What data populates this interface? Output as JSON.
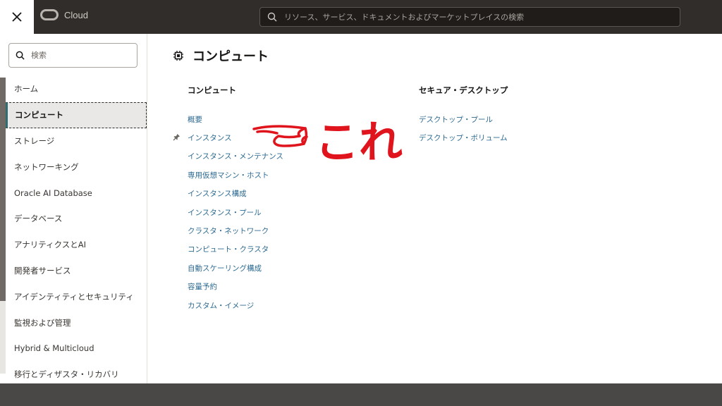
{
  "header": {
    "brand": "Cloud",
    "search_placeholder": "リソース、サービス、ドキュメントおよびマーケットプレイスの検索"
  },
  "sidebar": {
    "search_placeholder": "検索",
    "items": [
      {
        "label": "ホーム",
        "active": false
      },
      {
        "label": "コンピュート",
        "active": true
      },
      {
        "label": "ストレージ",
        "active": false
      },
      {
        "label": "ネットワーキング",
        "active": false
      },
      {
        "label": "Oracle AI Database",
        "active": false
      },
      {
        "label": "データベース",
        "active": false
      },
      {
        "label": "アナリティクスとAI",
        "active": false
      },
      {
        "label": "開発者サービス",
        "active": false
      },
      {
        "label": "アイデンティティとセキュリティ",
        "active": false
      },
      {
        "label": "監視および管理",
        "active": false
      },
      {
        "label": "Hybrid & Multicloud",
        "active": false
      },
      {
        "label": "移行とディザスタ・リカバリ",
        "active": false
      }
    ]
  },
  "main": {
    "title": "コンピュート",
    "columns": [
      {
        "heading": "コンピュート",
        "links": [
          {
            "label": "概要",
            "pinned": false
          },
          {
            "label": "インスタンス",
            "pinned": true
          },
          {
            "label": "インスタンス・メンテナンス",
            "pinned": false
          },
          {
            "label": "専用仮想マシン・ホスト",
            "pinned": false
          },
          {
            "label": "インスタンス構成",
            "pinned": false
          },
          {
            "label": "インスタンス・プール",
            "pinned": false
          },
          {
            "label": "クラスタ・ネットワーク",
            "pinned": false
          },
          {
            "label": "コンピュート・クラスタ",
            "pinned": false
          },
          {
            "label": "自動スケーリング構成",
            "pinned": false
          },
          {
            "label": "容量予約",
            "pinned": false
          },
          {
            "label": "カスタム・イメージ",
            "pinned": false
          }
        ]
      },
      {
        "heading": "セキュア・デスクトップ",
        "links": [
          {
            "label": "デスクトップ・プール",
            "pinned": false
          },
          {
            "label": "デスクトップ・ボリューム",
            "pinned": false
          }
        ]
      }
    ]
  },
  "annotation": {
    "text": "これ",
    "color": "#e0141c"
  },
  "colors": {
    "header_bg": "#312d2a",
    "link": "#2c6a92",
    "active_accent": "#2f6d73"
  }
}
